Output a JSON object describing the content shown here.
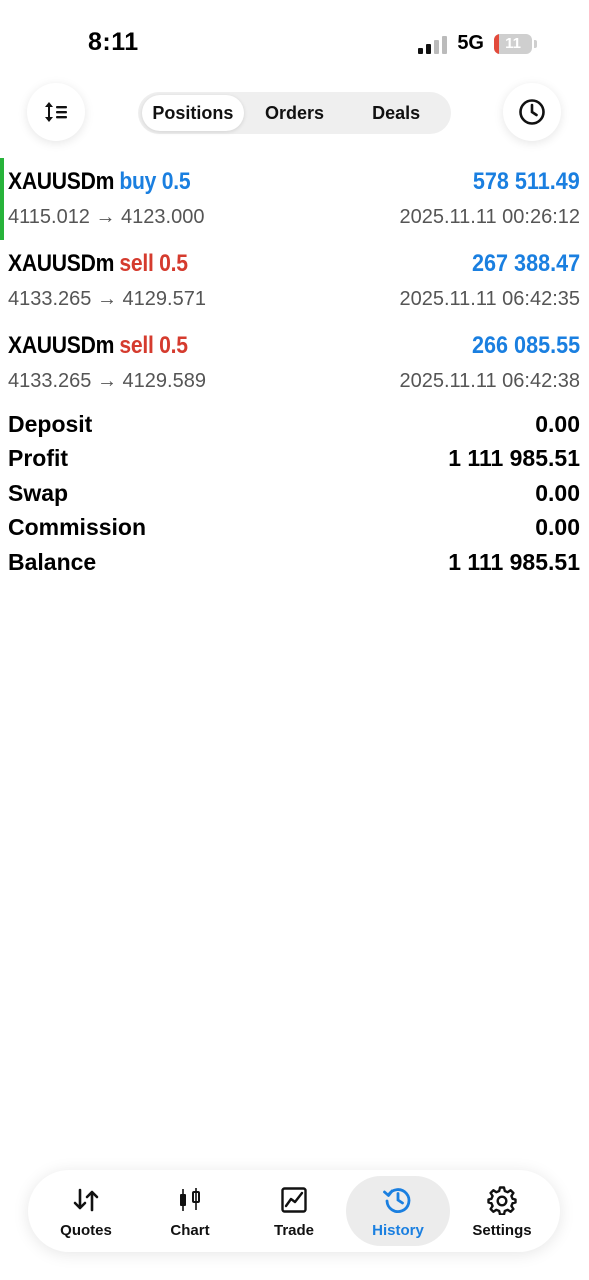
{
  "status_bar": {
    "time": "8:11",
    "network": "5G",
    "battery": "11"
  },
  "header": {
    "sort_icon": "sort-icon",
    "clock_icon": "clock-icon",
    "tabs": [
      {
        "label": "Positions",
        "active": true
      },
      {
        "label": "Orders",
        "active": false
      },
      {
        "label": "Deals",
        "active": false
      }
    ]
  },
  "deals": [
    {
      "symbol": "XAUUSDm",
      "side": "buy 0.5",
      "direction": "buy",
      "profit": "578 511.49",
      "prices": "4115.012 → 4123.000",
      "time": "2025.11.11 00:26:12",
      "highlighted": true
    },
    {
      "symbol": "XAUUSDm",
      "side": "sell 0.5",
      "direction": "sell",
      "profit": "267 388.47",
      "prices": "4133.265 → 4129.571",
      "time": "2025.11.11 06:42:35",
      "highlighted": false
    },
    {
      "symbol": "XAUUSDm",
      "side": "sell 0.5",
      "direction": "sell",
      "profit": "266 085.55",
      "prices": "4133.265 → 4129.589",
      "time": "2025.11.11 06:42:38",
      "highlighted": false
    }
  ],
  "summary": [
    {
      "label": "Deposit",
      "value": "0.00"
    },
    {
      "label": "Profit",
      "value": "1 111 985.51"
    },
    {
      "label": "Swap",
      "value": "0.00"
    },
    {
      "label": "Commission",
      "value": "0.00"
    },
    {
      "label": "Balance",
      "value": "1 111 985.51"
    }
  ],
  "tabbar": [
    {
      "label": "Quotes",
      "icon": "quotes-icon",
      "active": false
    },
    {
      "label": "Chart",
      "icon": "chart-icon",
      "active": false
    },
    {
      "label": "Trade",
      "icon": "trade-icon",
      "active": false
    },
    {
      "label": "History",
      "icon": "history-icon",
      "active": true
    },
    {
      "label": "Settings",
      "icon": "settings-icon",
      "active": false
    }
  ],
  "colors": {
    "accent": "#1a7fe0",
    "sell": "#d53b2e",
    "indicator": "#27b33a",
    "battery_low": "#e24a3b"
  }
}
